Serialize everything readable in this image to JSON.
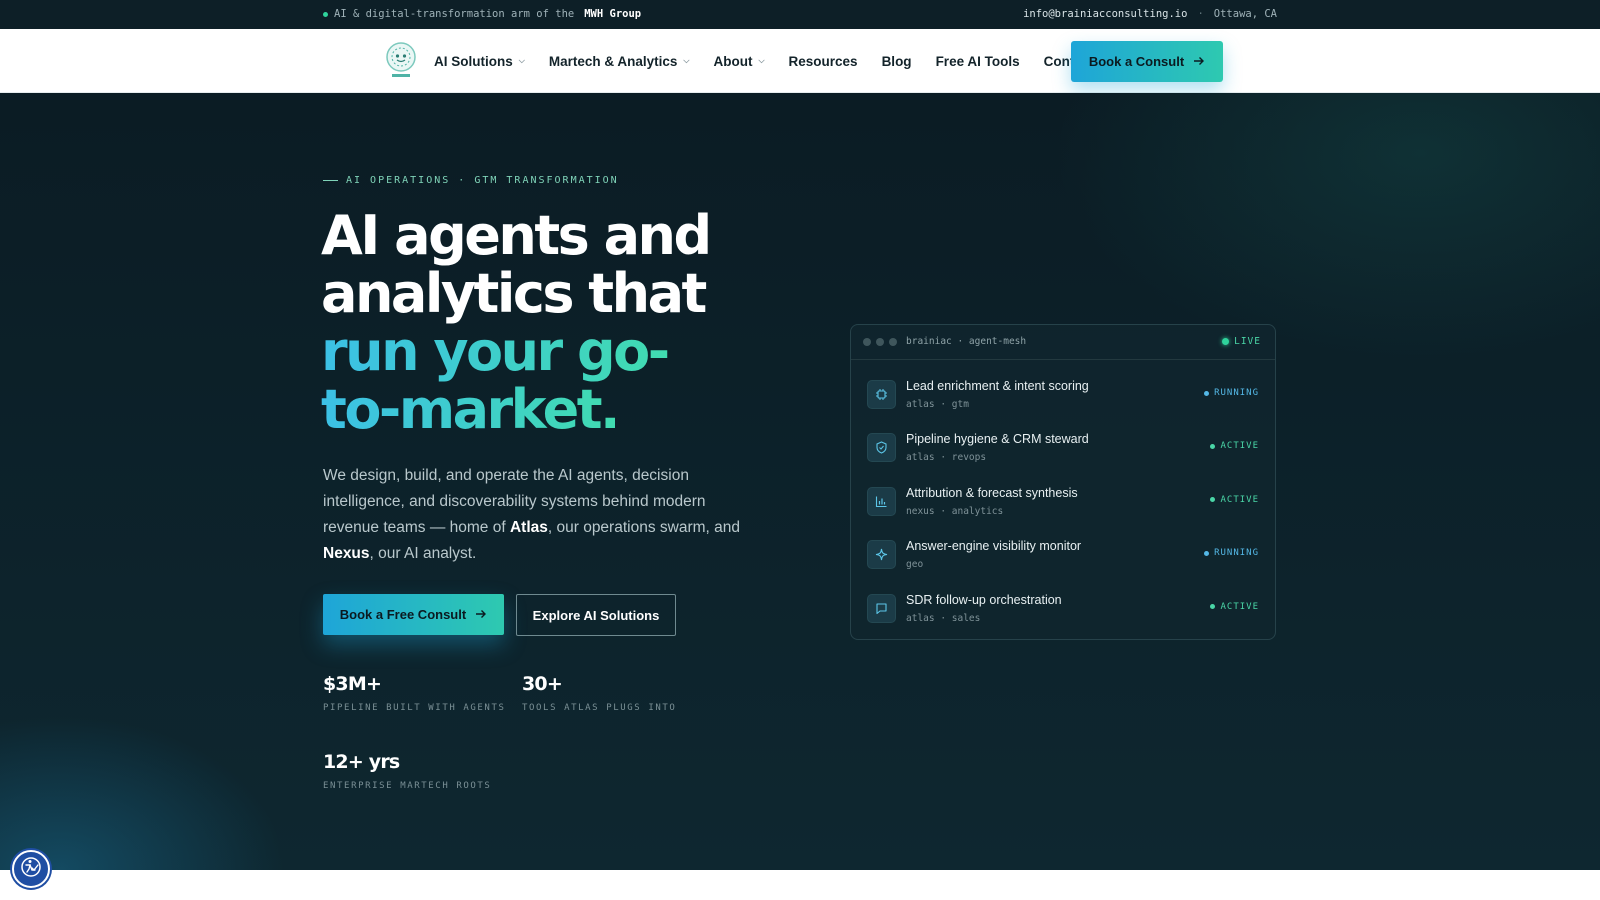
{
  "topbar": {
    "tagline_prefix": "AI & digital-transformation arm of the",
    "tagline_brand": "MWH Group",
    "email": "info@brainiacconsulting.io",
    "separator": "·",
    "location": "Ottawa, CA"
  },
  "nav": {
    "logo_icon": "brainiac-logo",
    "items": [
      {
        "label": "AI Solutions",
        "has_dropdown": true
      },
      {
        "label": "Martech & Analytics",
        "has_dropdown": true
      },
      {
        "label": "About",
        "has_dropdown": true
      },
      {
        "label": "Resources",
        "has_dropdown": false
      },
      {
        "label": "Blog",
        "has_dropdown": false
      },
      {
        "label": "Free AI Tools",
        "has_dropdown": false
      },
      {
        "label": "Contact",
        "has_dropdown": false
      }
    ],
    "cta_label": "Book a Consult",
    "cta_icon": "arrow-right-icon"
  },
  "hero": {
    "eyebrow": "AI OPERATIONS · GTM TRANSFORMATION",
    "headline_line1": "AI agents and",
    "headline_line2": "analytics that",
    "headline_accent1": "run your go-",
    "headline_accent2": "to-market.",
    "lead_part1": "We design, build, and operate the AI agents, decision intelligence, and discoverability systems behind modern revenue teams — home of ",
    "lead_atlas": "Atlas",
    "lead_part2": ", our operations swarm, and ",
    "lead_nexus": "Nexus",
    "lead_part3": ", our AI analyst.",
    "primary_button": "Book a Free Consult",
    "secondary_button": "Explore AI Solutions",
    "stats": [
      {
        "value": "$3M+",
        "label": "PIPELINE BUILT WITH AGENTS"
      },
      {
        "value": "30+",
        "label": "TOOLS ATLAS PLUGS INTO"
      },
      {
        "value": "12+ yrs",
        "label": "ENTERPRISE MARTECH ROOTS"
      }
    ]
  },
  "panel": {
    "title": "brainiac · agent-mesh",
    "live_label": "LIVE",
    "agents": [
      {
        "name": "Lead enrichment & intent scoring",
        "meta": "atlas · gtm",
        "status": "RUNNING",
        "icon": "chip-icon"
      },
      {
        "name": "Pipeline hygiene & CRM steward",
        "meta": "atlas · revops",
        "status": "ACTIVE",
        "icon": "shield-icon"
      },
      {
        "name": "Attribution & forecast synthesis",
        "meta": "nexus · analytics",
        "status": "ACTIVE",
        "icon": "bar-chart-icon"
      },
      {
        "name": "Answer-engine visibility monitor",
        "meta": "geo",
        "status": "RUNNING",
        "icon": "sparkle-icon"
      },
      {
        "name": "SDR follow-up orchestration",
        "meta": "atlas · sales",
        "status": "ACTIVE",
        "icon": "chat-icon"
      }
    ]
  },
  "accessibility": {
    "icon": "accessibility-icon"
  },
  "colors": {
    "accent_blue": "#1ea5d8",
    "accent_teal": "#2ec9b0",
    "status_active": "#4ad6a7",
    "status_running": "#54b8e6",
    "hero_bg": "#0b1c24"
  }
}
